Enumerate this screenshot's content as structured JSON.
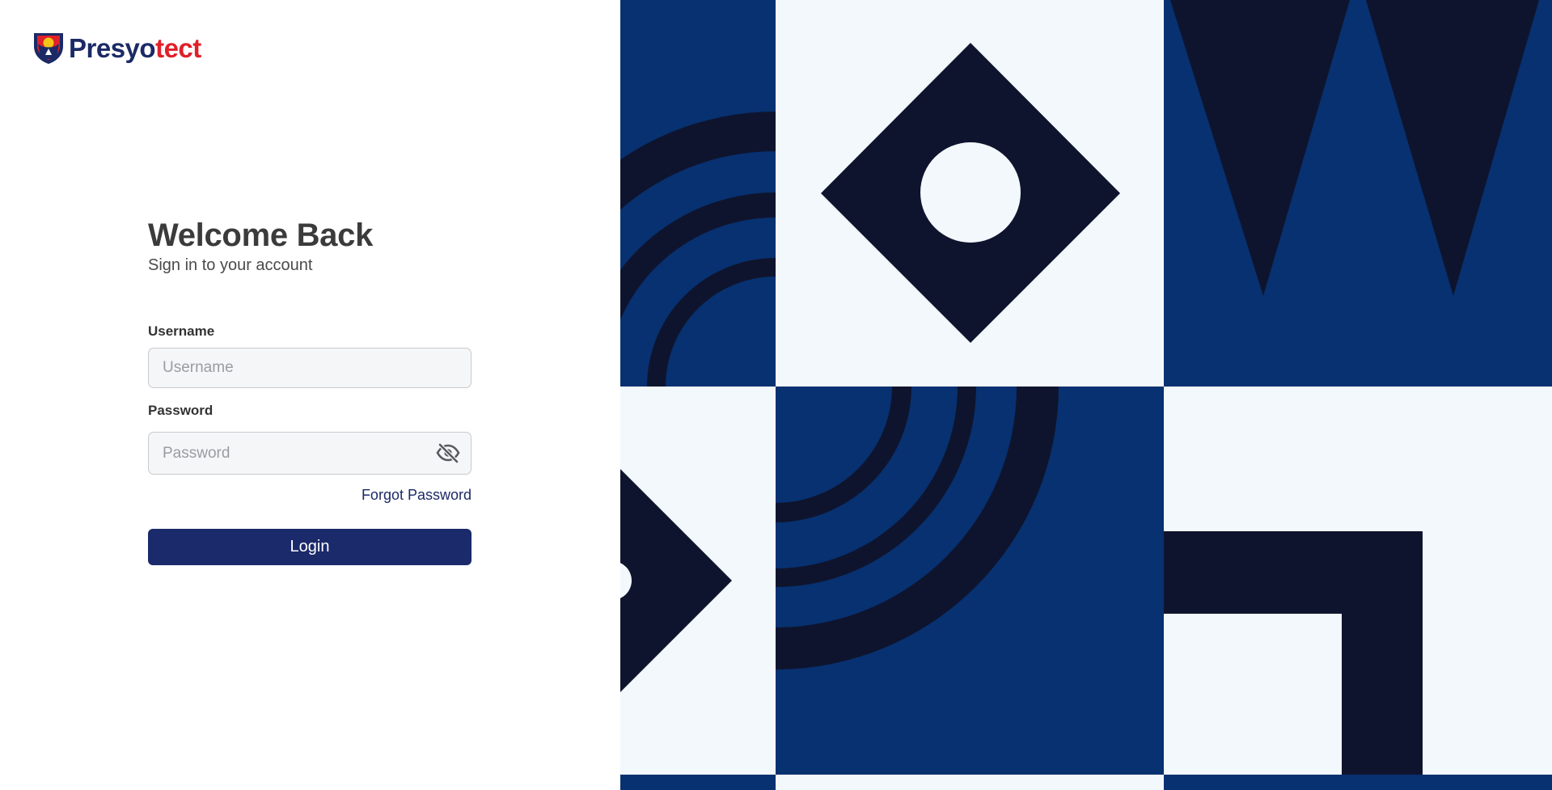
{
  "brand": {
    "name_part1": "Presyo",
    "name_part2": "tect",
    "logo_icon": "shield-logo-icon"
  },
  "login": {
    "title": "Welcome Back",
    "subtitle": "Sign in to your account",
    "username_label": "Username",
    "username_placeholder": "Username",
    "username_value": "",
    "password_label": "Password",
    "password_placeholder": "Password",
    "password_value": "",
    "password_toggle_icon": "eye-off-icon",
    "forgot_link": "Forgot Password",
    "login_button": "Login"
  },
  "colors": {
    "brand_navy": "#1b2a66",
    "brand_red": "#e0202a",
    "button_bg": "#1b2a6b",
    "art_blue": "#073170",
    "art_dark": "#0f142e",
    "art_light": "#f3f8fc"
  }
}
